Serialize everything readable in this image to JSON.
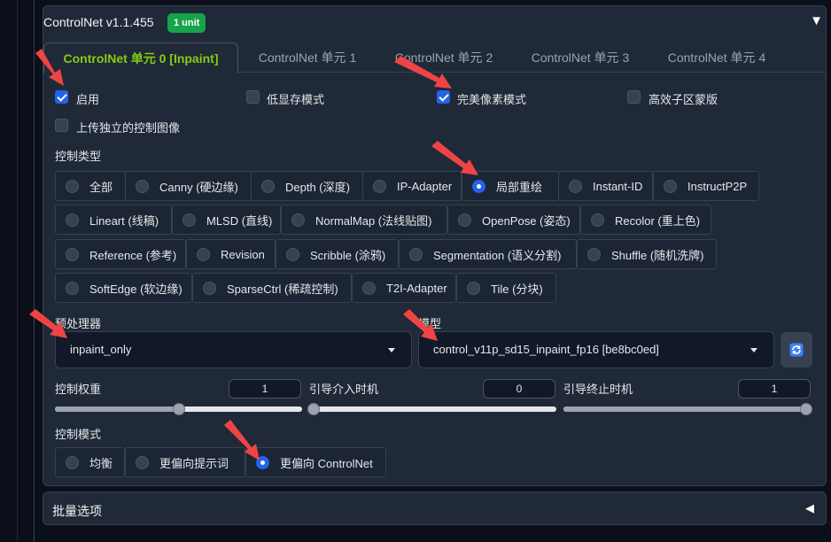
{
  "header": {
    "title": "ControlNet v1.1.455",
    "badge": "1 unit",
    "collapse_glyph": "▼"
  },
  "tabs": [
    {
      "label": "ControlNet 单元 0 [Inpaint]",
      "active": true
    },
    {
      "label": "ControlNet 单元 1",
      "active": false
    },
    {
      "label": "ControlNet 单元 2",
      "active": false
    },
    {
      "label": "ControlNet 单元 3",
      "active": false
    },
    {
      "label": "ControlNet 单元 4",
      "active": false
    }
  ],
  "options": {
    "enable": {
      "label": "启用",
      "checked": true
    },
    "low_vram": {
      "label": "低显存模式",
      "checked": false
    },
    "pixel_perfect": {
      "label": "完美像素模式",
      "checked": true
    },
    "efficient_mask": {
      "label": "高效子区蒙版",
      "checked": false
    },
    "upload_independent": {
      "label": "上传独立的控制图像",
      "checked": false
    }
  },
  "control_type": {
    "label": "控制类型",
    "items": [
      "全部",
      "Canny (硬边缘)",
      "Depth (深度)",
      "IP-Adapter",
      "局部重绘",
      "Instant-ID",
      "InstructP2P",
      "Lineart (线稿)",
      "MLSD (直线)",
      "NormalMap (法线贴图)",
      "OpenPose (姿态)",
      "Recolor (重上色)",
      "Reference (参考)",
      "Revision",
      "Scribble (涂鸦)",
      "Segmentation (语义分割)",
      "Shuffle (随机洗牌)",
      "SoftEdge (软边缘)",
      "SparseCtrl (稀疏控制)",
      "T2I-Adapter",
      "Tile (分块)"
    ],
    "selected": "局部重绘"
  },
  "preprocessor": {
    "label": "预处理器",
    "value": "inpaint_only"
  },
  "model": {
    "label": "模型",
    "value": "control_v11p_sd15_inpaint_fp16 [be8bc0ed]"
  },
  "sliders": [
    {
      "label": "控制权重",
      "value": "1",
      "fraction": 0.5
    },
    {
      "label": "引导介入时机",
      "value": "0",
      "fraction": 0.0
    },
    {
      "label": "引导终止时机",
      "value": "1",
      "fraction": 1.0
    }
  ],
  "control_mode": {
    "label": "控制模式",
    "items": [
      "均衡",
      "更偏向提示词",
      "更偏向 ControlNet"
    ],
    "selected": "更偏向 ControlNet"
  },
  "batch": {
    "label": "批量选项",
    "expand_glyph": "◀"
  },
  "colors": {
    "accent": "#2563eb",
    "active_tab": "#84cc16",
    "badge": "#16a34a",
    "annotation": "#ef4444"
  },
  "icons": {
    "refresh": "refresh-icon"
  }
}
